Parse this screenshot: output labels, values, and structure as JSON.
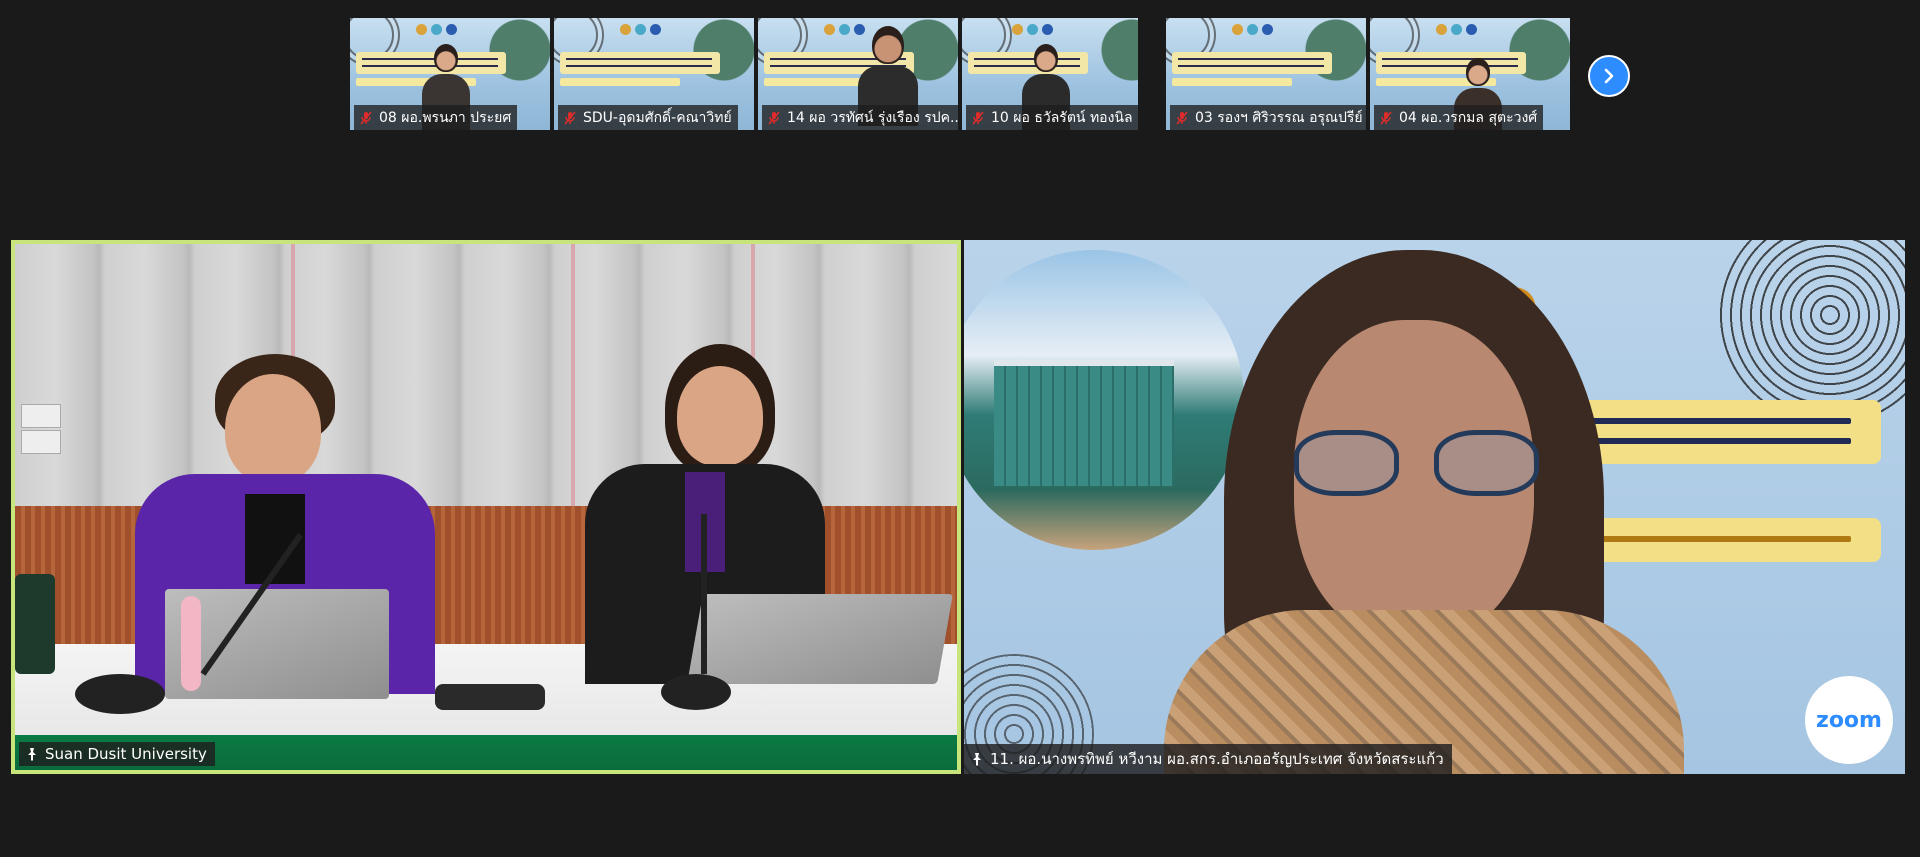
{
  "thumbnails": [
    {
      "name": "08 ผอ.พรนภา  ประยศ",
      "mic": "muted"
    },
    {
      "name": "SDU-อุดมศักดิ์-คณาวิทย์",
      "mic": "muted"
    },
    {
      "name": "14 ผอ วรทัศน์ รุ่งเรือง รปค...",
      "mic": "muted"
    },
    {
      "name": "10 ผอ ธวัลรัตน์ ทองนิล",
      "mic": "muted"
    },
    {
      "name": "03 รองฯ ศิริวรรณ อรุณปรีย์",
      "mic": "muted"
    },
    {
      "name": "04 ผอ.วรกมล สุตะวงศ์",
      "mic": "muted"
    }
  ],
  "next_button": {
    "icon": "chevron-right-icon"
  },
  "main_tiles": [
    {
      "name": "Suan Dusit University",
      "pinned": true,
      "active_speaker": true
    },
    {
      "name": "11. ผอ.นางพรทิพย์ หวีงาม ผอ.สกร.อำเภออรัญประเทศ จังหวัดสระแก้ว",
      "pinned": true
    }
  ],
  "colors": {
    "background": "#1a1a1a",
    "active_speaker_border": "#c7e57b",
    "mic_muted": "#e02b2b",
    "accent": "#2d8cff"
  }
}
